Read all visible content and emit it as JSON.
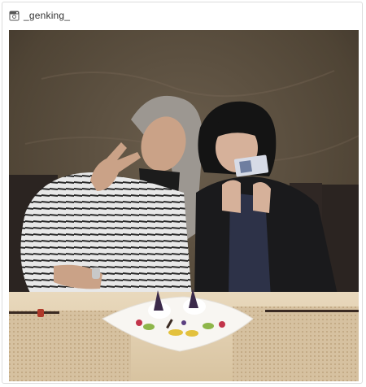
{
  "post": {
    "username": "_genking_",
    "platform_icon": "instagram-icon"
  },
  "photo": {
    "description_icon": "photo"
  },
  "colors": {
    "wall": "#5a4d3e",
    "table": "#e8d7bb",
    "placemat": "#cfb996",
    "plate": "#f7f5f2"
  }
}
